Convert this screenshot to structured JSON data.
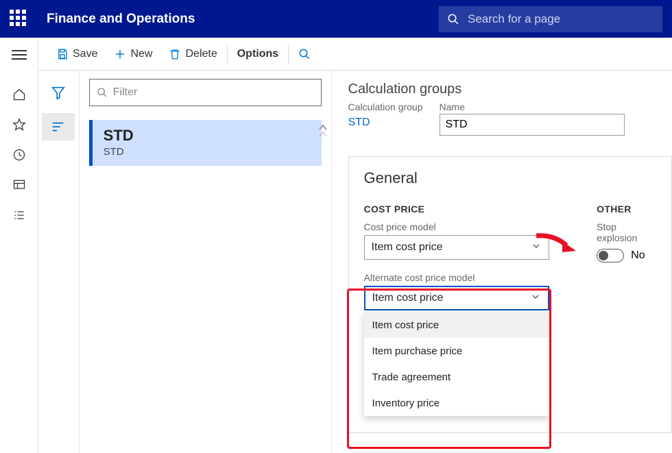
{
  "header": {
    "app_title": "Finance and Operations",
    "search_placeholder": "Search for a page"
  },
  "toolbar": {
    "save": "Save",
    "new": "New",
    "delete": "Delete",
    "options": "Options"
  },
  "list": {
    "filter_placeholder": "Filter",
    "item": {
      "title": "STD",
      "subtitle": "STD"
    }
  },
  "detail": {
    "page_title": "Calculation groups",
    "calc_group_label": "Calculation group",
    "calc_group_value": "STD",
    "name_label": "Name",
    "name_value": "STD",
    "general_title": "General",
    "cost_price_section": "COST PRICE",
    "cost_price_model_label": "Cost price model",
    "cost_price_model_value": "Item cost price",
    "alt_cost_label": "Alternate cost price model",
    "alt_cost_value": "Item cost price",
    "alt_cost_options": [
      "Item cost price",
      "Item purchase price",
      "Trade agreement",
      "Inventory price"
    ],
    "other_section": "OTHER",
    "stop_explosion_label": "Stop explosion",
    "stop_explosion_value": "No"
  }
}
